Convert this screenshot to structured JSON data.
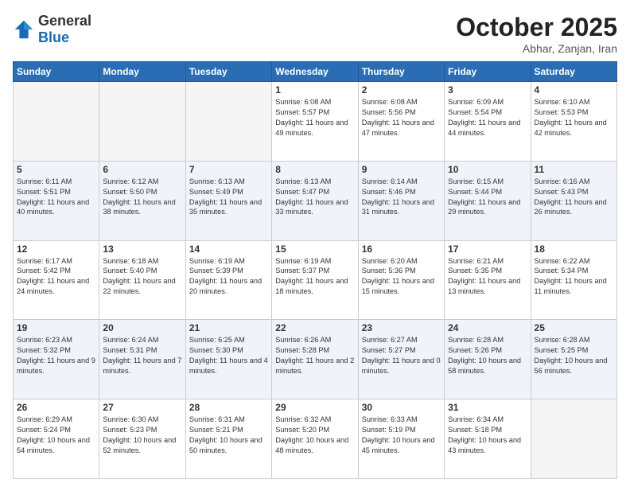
{
  "header": {
    "logo_general": "General",
    "logo_blue": "Blue",
    "month": "October 2025",
    "location": "Abhar, Zanjan, Iran"
  },
  "weekdays": [
    "Sunday",
    "Monday",
    "Tuesday",
    "Wednesday",
    "Thursday",
    "Friday",
    "Saturday"
  ],
  "weeks": [
    [
      {
        "day": "",
        "info": ""
      },
      {
        "day": "",
        "info": ""
      },
      {
        "day": "",
        "info": ""
      },
      {
        "day": "1",
        "info": "Sunrise: 6:08 AM\nSunset: 5:57 PM\nDaylight: 11 hours and 49 minutes."
      },
      {
        "day": "2",
        "info": "Sunrise: 6:08 AM\nSunset: 5:56 PM\nDaylight: 11 hours and 47 minutes."
      },
      {
        "day": "3",
        "info": "Sunrise: 6:09 AM\nSunset: 5:54 PM\nDaylight: 11 hours and 44 minutes."
      },
      {
        "day": "4",
        "info": "Sunrise: 6:10 AM\nSunset: 5:53 PM\nDaylight: 11 hours and 42 minutes."
      }
    ],
    [
      {
        "day": "5",
        "info": "Sunrise: 6:11 AM\nSunset: 5:51 PM\nDaylight: 11 hours and 40 minutes."
      },
      {
        "day": "6",
        "info": "Sunrise: 6:12 AM\nSunset: 5:50 PM\nDaylight: 11 hours and 38 minutes."
      },
      {
        "day": "7",
        "info": "Sunrise: 6:13 AM\nSunset: 5:49 PM\nDaylight: 11 hours and 35 minutes."
      },
      {
        "day": "8",
        "info": "Sunrise: 6:13 AM\nSunset: 5:47 PM\nDaylight: 11 hours and 33 minutes."
      },
      {
        "day": "9",
        "info": "Sunrise: 6:14 AM\nSunset: 5:46 PM\nDaylight: 11 hours and 31 minutes."
      },
      {
        "day": "10",
        "info": "Sunrise: 6:15 AM\nSunset: 5:44 PM\nDaylight: 11 hours and 29 minutes."
      },
      {
        "day": "11",
        "info": "Sunrise: 6:16 AM\nSunset: 5:43 PM\nDaylight: 11 hours and 26 minutes."
      }
    ],
    [
      {
        "day": "12",
        "info": "Sunrise: 6:17 AM\nSunset: 5:42 PM\nDaylight: 11 hours and 24 minutes."
      },
      {
        "day": "13",
        "info": "Sunrise: 6:18 AM\nSunset: 5:40 PM\nDaylight: 11 hours and 22 minutes."
      },
      {
        "day": "14",
        "info": "Sunrise: 6:19 AM\nSunset: 5:39 PM\nDaylight: 11 hours and 20 minutes."
      },
      {
        "day": "15",
        "info": "Sunrise: 6:19 AM\nSunset: 5:37 PM\nDaylight: 11 hours and 18 minutes."
      },
      {
        "day": "16",
        "info": "Sunrise: 6:20 AM\nSunset: 5:36 PM\nDaylight: 11 hours and 15 minutes."
      },
      {
        "day": "17",
        "info": "Sunrise: 6:21 AM\nSunset: 5:35 PM\nDaylight: 11 hours and 13 minutes."
      },
      {
        "day": "18",
        "info": "Sunrise: 6:22 AM\nSunset: 5:34 PM\nDaylight: 11 hours and 11 minutes."
      }
    ],
    [
      {
        "day": "19",
        "info": "Sunrise: 6:23 AM\nSunset: 5:32 PM\nDaylight: 11 hours and 9 minutes."
      },
      {
        "day": "20",
        "info": "Sunrise: 6:24 AM\nSunset: 5:31 PM\nDaylight: 11 hours and 7 minutes."
      },
      {
        "day": "21",
        "info": "Sunrise: 6:25 AM\nSunset: 5:30 PM\nDaylight: 11 hours and 4 minutes."
      },
      {
        "day": "22",
        "info": "Sunrise: 6:26 AM\nSunset: 5:28 PM\nDaylight: 11 hours and 2 minutes."
      },
      {
        "day": "23",
        "info": "Sunrise: 6:27 AM\nSunset: 5:27 PM\nDaylight: 11 hours and 0 minutes."
      },
      {
        "day": "24",
        "info": "Sunrise: 6:28 AM\nSunset: 5:26 PM\nDaylight: 10 hours and 58 minutes."
      },
      {
        "day": "25",
        "info": "Sunrise: 6:28 AM\nSunset: 5:25 PM\nDaylight: 10 hours and 56 minutes."
      }
    ],
    [
      {
        "day": "26",
        "info": "Sunrise: 6:29 AM\nSunset: 5:24 PM\nDaylight: 10 hours and 54 minutes."
      },
      {
        "day": "27",
        "info": "Sunrise: 6:30 AM\nSunset: 5:23 PM\nDaylight: 10 hours and 52 minutes."
      },
      {
        "day": "28",
        "info": "Sunrise: 6:31 AM\nSunset: 5:21 PM\nDaylight: 10 hours and 50 minutes."
      },
      {
        "day": "29",
        "info": "Sunrise: 6:32 AM\nSunset: 5:20 PM\nDaylight: 10 hours and 48 minutes."
      },
      {
        "day": "30",
        "info": "Sunrise: 6:33 AM\nSunset: 5:19 PM\nDaylight: 10 hours and 45 minutes."
      },
      {
        "day": "31",
        "info": "Sunrise: 6:34 AM\nSunset: 5:18 PM\nDaylight: 10 hours and 43 minutes."
      },
      {
        "day": "",
        "info": ""
      }
    ]
  ]
}
